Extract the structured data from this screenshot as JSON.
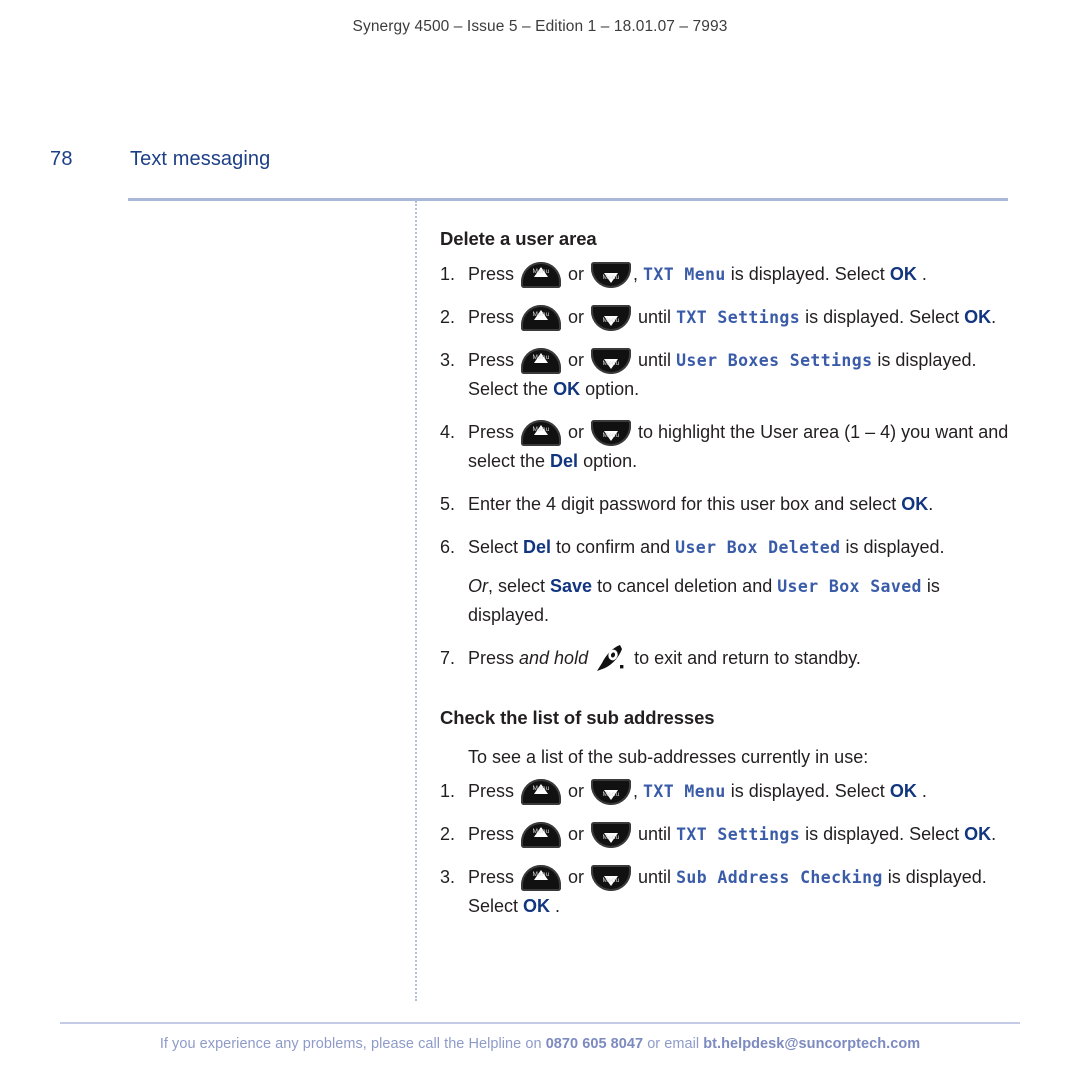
{
  "header": {
    "running_head": "Synergy 4500 – Issue 5 –  Edition 1 – 18.01.07 – 7993"
  },
  "page": {
    "number": "78",
    "title": "Text messaging"
  },
  "icons": {
    "menu_up": "menu-up-button-icon",
    "menu_down": "menu-down-button-icon",
    "menu_label": "Menu",
    "hangup": "hangup-phone-icon"
  },
  "sections": [
    {
      "heading": "Delete a user area",
      "intro": "",
      "steps": [
        {
          "num": "1.",
          "parts": [
            {
              "type": "text",
              "value": "Press "
            },
            {
              "type": "icon",
              "value": "menu_up"
            },
            {
              "type": "text",
              "value": " or "
            },
            {
              "type": "icon",
              "value": "menu_down"
            },
            {
              "type": "text",
              "value": ", "
            },
            {
              "type": "lcd",
              "value": "TXT Menu"
            },
            {
              "type": "text",
              "value": " is displayed. Select "
            },
            {
              "type": "softkey",
              "value": "OK"
            },
            {
              "type": "text",
              "value": " ."
            }
          ]
        },
        {
          "num": "2.",
          "parts": [
            {
              "type": "text",
              "value": "Press "
            },
            {
              "type": "icon",
              "value": "menu_up"
            },
            {
              "type": "text",
              "value": " or "
            },
            {
              "type": "icon",
              "value": "menu_down"
            },
            {
              "type": "text",
              "value": " until "
            },
            {
              "type": "lcd",
              "value": "TXT Settings"
            },
            {
              "type": "text",
              "value": " is displayed. Select "
            },
            {
              "type": "softkey",
              "value": "OK"
            },
            {
              "type": "text",
              "value": "."
            }
          ]
        },
        {
          "num": "3.",
          "parts": [
            {
              "type": "text",
              "value": "Press "
            },
            {
              "type": "icon",
              "value": "menu_up"
            },
            {
              "type": "text",
              "value": " or "
            },
            {
              "type": "icon",
              "value": "menu_down"
            },
            {
              "type": "text",
              "value": " until "
            },
            {
              "type": "lcd",
              "value": "User Boxes Settings"
            },
            {
              "type": "text",
              "value": " is displayed. Select the "
            },
            {
              "type": "softkey",
              "value": "OK"
            },
            {
              "type": "text",
              "value": " option."
            }
          ]
        },
        {
          "num": "4.",
          "parts": [
            {
              "type": "text",
              "value": "Press "
            },
            {
              "type": "icon",
              "value": "menu_up"
            },
            {
              "type": "text",
              "value": " or "
            },
            {
              "type": "icon",
              "value": "menu_down"
            },
            {
              "type": "text",
              "value": " to highlight the User area (1 – 4) you want and select the "
            },
            {
              "type": "softkey",
              "value": "Del"
            },
            {
              "type": "text",
              "value": " option."
            }
          ]
        },
        {
          "num": "5.",
          "parts": [
            {
              "type": "text",
              "value": "Enter the 4 digit password for this user box and select "
            },
            {
              "type": "softkey",
              "value": "OK"
            },
            {
              "type": "text",
              "value": "."
            }
          ]
        },
        {
          "num": "6.",
          "parts": [
            {
              "type": "text",
              "value": "Select "
            },
            {
              "type": "softkey",
              "value": "Del"
            },
            {
              "type": "text",
              "value": " to confirm and "
            },
            {
              "type": "lcd",
              "value": "User Box Deleted"
            },
            {
              "type": "text",
              "value": " is displayed."
            }
          ],
          "sub_para": [
            {
              "type": "italic",
              "value": "Or"
            },
            {
              "type": "text",
              "value": ", select "
            },
            {
              "type": "softkey",
              "value": "Save"
            },
            {
              "type": "text",
              "value": " to cancel deletion and "
            },
            {
              "type": "lcd",
              "value": "User Box Saved"
            },
            {
              "type": "text",
              "value": " is displayed."
            }
          ]
        },
        {
          "num": "7.",
          "parts": [
            {
              "type": "text",
              "value": "Press "
            },
            {
              "type": "italic",
              "value": "and hold"
            },
            {
              "type": "text",
              "value": " "
            },
            {
              "type": "icon",
              "value": "hangup"
            },
            {
              "type": "text",
              "value": " to exit and return to standby."
            }
          ]
        }
      ]
    },
    {
      "heading": "Check the list of sub addresses",
      "intro": "To see a list of the sub-addresses currently in use:",
      "steps": [
        {
          "num": "1.",
          "parts": [
            {
              "type": "text",
              "value": "Press "
            },
            {
              "type": "icon",
              "value": "menu_up"
            },
            {
              "type": "text",
              "value": " or "
            },
            {
              "type": "icon",
              "value": "menu_down"
            },
            {
              "type": "text",
              "value": ", "
            },
            {
              "type": "lcd",
              "value": "TXT Menu"
            },
            {
              "type": "text",
              "value": " is displayed. Select "
            },
            {
              "type": "softkey",
              "value": "OK"
            },
            {
              "type": "text",
              "value": " ."
            }
          ]
        },
        {
          "num": "2.",
          "parts": [
            {
              "type": "text",
              "value": "Press "
            },
            {
              "type": "icon",
              "value": "menu_up"
            },
            {
              "type": "text",
              "value": " or "
            },
            {
              "type": "icon",
              "value": "menu_down"
            },
            {
              "type": "text",
              "value": " until "
            },
            {
              "type": "lcd",
              "value": "TXT Settings"
            },
            {
              "type": "text",
              "value": " is displayed. Select "
            },
            {
              "type": "softkey",
              "value": "OK"
            },
            {
              "type": "text",
              "value": "."
            }
          ]
        },
        {
          "num": "3.",
          "parts": [
            {
              "type": "text",
              "value": "Press "
            },
            {
              "type": "icon",
              "value": "menu_up"
            },
            {
              "type": "text",
              "value": " or "
            },
            {
              "type": "icon",
              "value": "menu_down"
            },
            {
              "type": "text",
              "value": " until "
            },
            {
              "type": "lcd",
              "value": "Sub Address Checking"
            },
            {
              "type": "text",
              "value": " is displayed. Select "
            },
            {
              "type": "softkey",
              "value": "OK"
            },
            {
              "type": "text",
              "value": " ."
            }
          ]
        }
      ]
    }
  ],
  "footer": {
    "lead": "If you experience any problems, please call the Helpline on ",
    "phone": "0870 605 8047",
    "middle": " or email ",
    "email": "bt.helpdesk@suncorptech.com"
  },
  "colors": {
    "title_blue": "#1c3f86",
    "lcd_blue": "#3a5ca8",
    "softkey_navy": "#12357f",
    "rule_blue": "#a9b7d8",
    "footer_blue": "#8e9bc8"
  }
}
